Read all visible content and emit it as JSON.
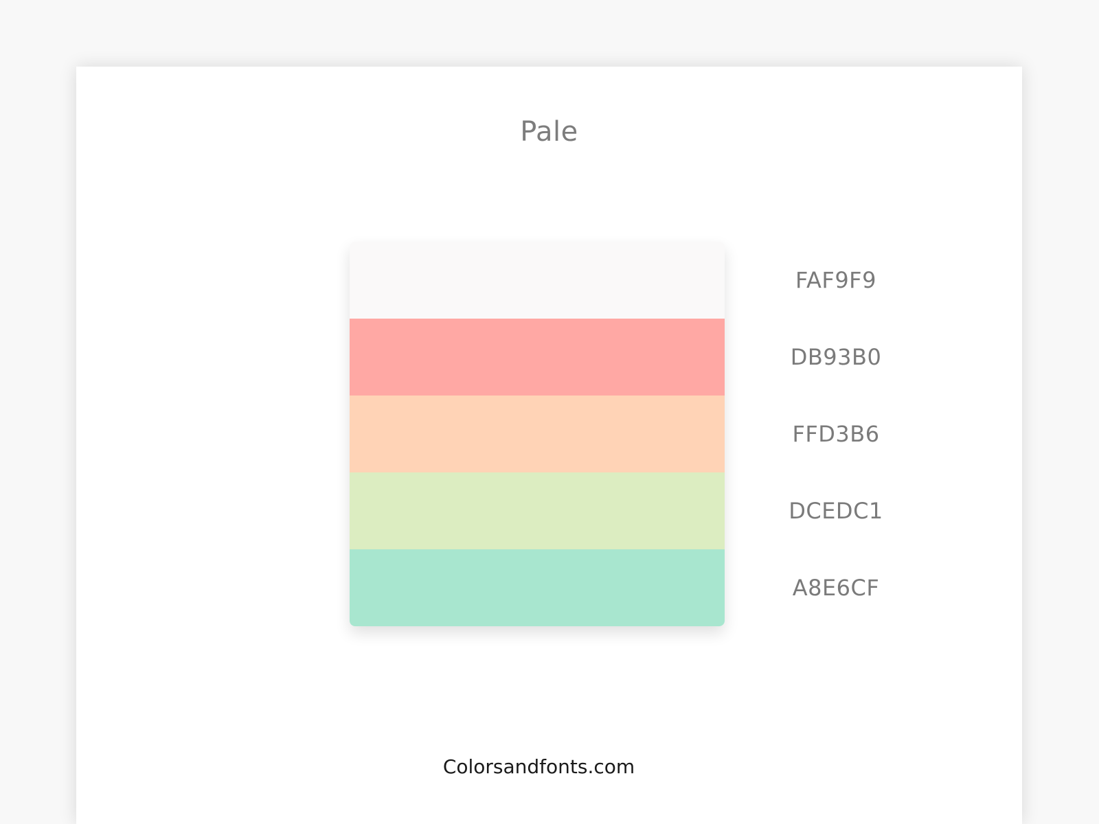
{
  "title": "Pale",
  "colors": [
    {
      "hex_label": "FAF9F9",
      "hex": "#FAF9F9"
    },
    {
      "hex_label": "DB93B0",
      "hex": "#FFA8A4"
    },
    {
      "hex_label": "FFD3B6",
      "hex": "#FFD3B6"
    },
    {
      "hex_label": "DCEDC1",
      "hex": "#DCEDC1"
    },
    {
      "hex_label": "A8E6CF",
      "hex": "#A8E6CF"
    }
  ],
  "footer": "Colorsandfonts.com"
}
